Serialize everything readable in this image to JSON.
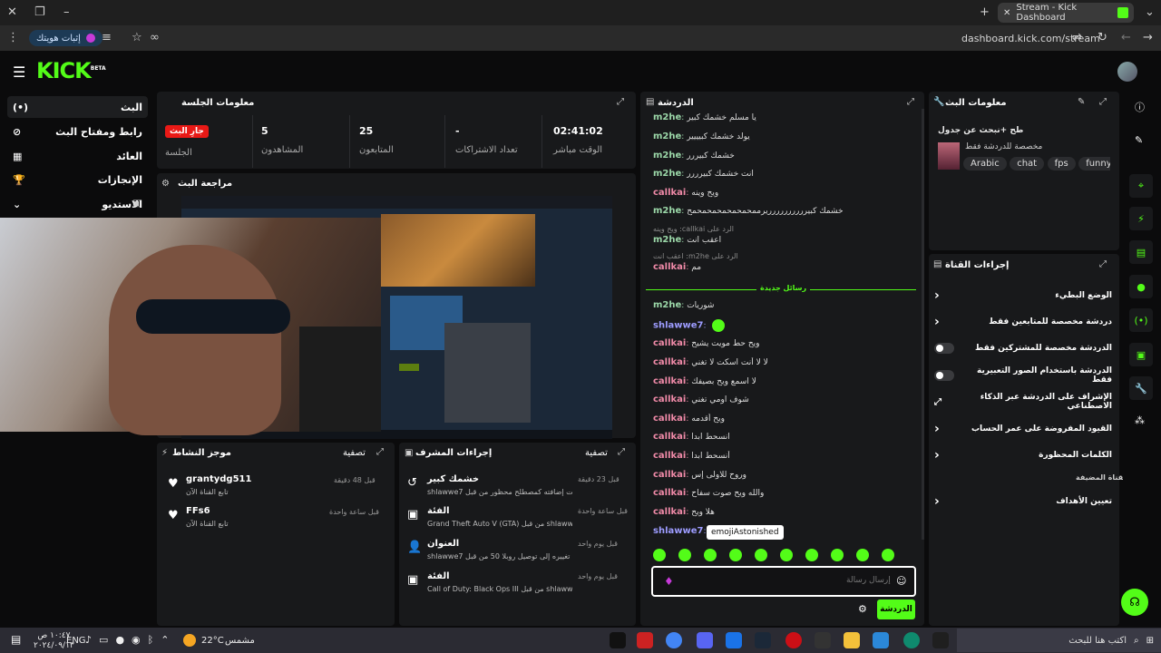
{
  "browser": {
    "tab_title": "Stream - Kick Dashboard",
    "url": "dashboard.kick.com/stream",
    "verify_identity": "إثبات هويتك"
  },
  "app": {
    "logo": "KICK",
    "logo_sup": "BETA"
  },
  "nav": [
    {
      "label": "البث",
      "icon": "live-icon"
    },
    {
      "label": "رابط ومفتاح البث",
      "icon": "link-icon"
    },
    {
      "label": "العائد",
      "icon": "chart-icon"
    },
    {
      "label": "الإنجازات",
      "icon": "trophy-icon"
    },
    {
      "label": "الاستديو",
      "icon": "chevron-down-icon"
    }
  ],
  "session": {
    "title": "معلومات الجلسة",
    "stats": [
      {
        "value": "",
        "label": "الجلسة",
        "badge": "جارِ البث"
      },
      {
        "value": "5",
        "label": "المشاهدون"
      },
      {
        "value": "25",
        "label": "المتابعون"
      },
      {
        "value": "-",
        "label": "تعداد الاشتراكات"
      },
      {
        "value": "02:41:02",
        "label": "الوقت مباشر"
      }
    ]
  },
  "preview": {
    "title": "مراجعة البث"
  },
  "activity": {
    "title": "موجز النشاط",
    "filter": "تصفية",
    "items": [
      {
        "name": "grantydg511",
        "desc": "تابع القناة الآن",
        "time": "قبل 48 دقيقة"
      },
      {
        "name": "FFs6",
        "desc": "تابع القناة الآن",
        "time": "قبل ساعة واحدة"
      }
    ]
  },
  "mod_actions": {
    "title": "إجراءات المشرف",
    "filter": "تصفية",
    "items": [
      {
        "title": "خشمك كبير",
        "desc": "shlawwe7 تمت إضافته كمصطلح محظور من قبل",
        "time": "قبل 23 دقيقة"
      },
      {
        "title": "الفئة",
        "desc": "Grand Theft Auto V (GTA) من قبل shlawwe7 تم تغييره إلى",
        "time": "قبل ساعة واحدة"
      },
      {
        "title": "العنوان",
        "desc": "shlawwe7 تم تغييره إلى توصيل روبلا 50 من قبل",
        "time": "قبل يوم واحد"
      },
      {
        "title": "الفئة",
        "desc": "Call of Duty: Black Ops III من قبل shlawwe7 تم تغييره إلى",
        "time": "قبل يوم واحد"
      }
    ]
  },
  "chat": {
    "title": "الدردشة",
    "new_messages": "رسائل جديدة",
    "tooltip": "emojiAstonished",
    "input_placeholder": "إرسال رسالة",
    "send_label": "الدردشة",
    "messages": [
      {
        "user": "m2he",
        "text": "يا مسلم خشمك كبير",
        "color": "green"
      },
      {
        "user": "m2he",
        "text": "يولد خشمك كبيييير",
        "color": "green"
      },
      {
        "user": "m2he",
        "text": "خشمك كبيررر",
        "color": "green"
      },
      {
        "user": "m2he",
        "text": "انت خشمك كبيرررر",
        "color": "green"
      },
      {
        "user": "callkai",
        "text": "ويح وينه",
        "color": "pink"
      },
      {
        "user": "m2he",
        "text": "خشمك كبيرررررررررريرممحمحمحمحمحمحمح",
        "color": "green"
      },
      {
        "user": "m2he",
        "text": "اعقب انت",
        "color": "green",
        "reply": "الرد على callkai: ويح وينه"
      },
      {
        "user": "callkai",
        "text": "مم",
        "color": "pink",
        "reply": "الرد على m2he: اعقب انت"
      },
      {
        "user": "m2he",
        "text": "شوريات",
        "color": "green"
      },
      {
        "user": "shlawwe7",
        "text": "",
        "color": "purple",
        "emoji": true
      },
      {
        "user": "callkai",
        "text": "ويح حط مويت يشيح",
        "color": "pink"
      },
      {
        "user": "callkai",
        "text": "لا لا أنت اسكت لا تغني",
        "color": "pink"
      },
      {
        "user": "callkai",
        "text": "لا اسمع ويح بصيفك",
        "color": "pink"
      },
      {
        "user": "callkai",
        "text": "شوف اومي تغني",
        "color": "pink"
      },
      {
        "user": "callkai",
        "text": "ويح أقدمه",
        "color": "pink"
      },
      {
        "user": "callkai",
        "text": "انسحط ابدا",
        "color": "pink"
      },
      {
        "user": "callkai",
        "text": "أنسحط ابدا",
        "color": "pink"
      },
      {
        "user": "callkai",
        "text": "وروح للاولى إس",
        "color": "pink"
      },
      {
        "user": "callkai",
        "text": "والله ويح صوت سفاح",
        "color": "pink"
      },
      {
        "user": "callkai",
        "text": "هلا ويح",
        "color": "pink"
      },
      {
        "user": "shlawwe7",
        "text": "",
        "color": "purple"
      }
    ]
  },
  "stream_info": {
    "title": "معلومات البث",
    "stream_title": "طح +نبحث عن جدول",
    "subtitle": "مخصصة للدردشة فقط",
    "tags": [
      "Arabic",
      "chat",
      "fps",
      "funny",
      "g"
    ]
  },
  "channel_actions": {
    "title": "إجراءات القناة",
    "rows": [
      {
        "label": "الوضع البطيء",
        "control": "chevron"
      },
      {
        "label": "دردشة مخصصة للمتابعين فقط",
        "control": "chevron"
      },
      {
        "label": "الدردشة مخصصة للمشتركين فقط",
        "control": "toggle"
      },
      {
        "label": "الدردشة باستخدام الصور التعبيرية فقط",
        "control": "toggle"
      },
      {
        "label": "الإشراف على الدردشة عبر الذكاء الاصطناعي",
        "control": "external"
      },
      {
        "label": "القيود المفروضة على عمر الحساب",
        "control": "chevron"
      },
      {
        "label": "الكلمات المحظورة",
        "control": "chevron"
      }
    ],
    "section": "القناة المضيفة",
    "target": "تعيين الأهداف"
  },
  "taskbar": {
    "search": "اكتب هنا للبحث",
    "weather": "22°C",
    "weather_desc": "مشمس",
    "lang": "ENG",
    "time": "١٠:٤٧ ص",
    "date": "٢٠٢٤/٠٩/١٣"
  },
  "colors": {
    "accent": "#53fc18",
    "live": "#e91916"
  }
}
